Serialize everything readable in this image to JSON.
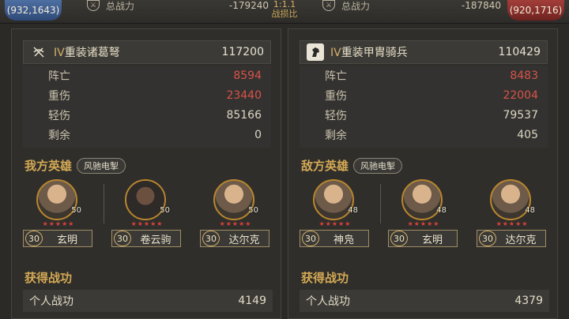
{
  "top": {
    "left_coord": "(932,1643)",
    "right_coord": "(920,1716)",
    "left_power_label": "总战力",
    "left_power_value": "-179240",
    "right_power_label": "总战力",
    "right_power_value": "-187840",
    "ratio_value": "1:1.1",
    "ratio_label": "战损比"
  },
  "left": {
    "unit": {
      "tier": "IV",
      "name": "重装诸葛弩",
      "total": "117200"
    },
    "stats": [
      {
        "label": "阵亡",
        "value": "8594",
        "red": true
      },
      {
        "label": "重伤",
        "value": "23440",
        "red": true
      },
      {
        "label": "轻伤",
        "value": "85166",
        "red": false
      },
      {
        "label": "剩余",
        "value": "0",
        "red": false
      }
    ],
    "heroes_title": "我方英雄",
    "tag": "风驰电掣",
    "heroes": [
      {
        "name": "玄明",
        "level": "50",
        "badge": "30",
        "stars": "★★★★★"
      },
      {
        "name": "卷云驹",
        "level": "50",
        "badge": "30",
        "stars": "★★★★★"
      },
      {
        "name": "达尔克",
        "level": "50",
        "badge": "30",
        "stars": "★★★★★"
      }
    ],
    "merit_title": "获得战功",
    "merit_label": "个人战功",
    "merit_value": "4149"
  },
  "right": {
    "unit": {
      "tier": "IV",
      "name": "重装甲胄骑兵",
      "total": "110429"
    },
    "stats": [
      {
        "label": "阵亡",
        "value": "8483",
        "red": true
      },
      {
        "label": "重伤",
        "value": "22004",
        "red": true
      },
      {
        "label": "轻伤",
        "value": "79537",
        "red": false
      },
      {
        "label": "剩余",
        "value": "405",
        "red": false
      }
    ],
    "heroes_title": "敌方英雄",
    "tag": "风驰电掣",
    "heroes": [
      {
        "name": "神凫",
        "level": "48",
        "badge": "30",
        "stars": "★★★★★"
      },
      {
        "name": "玄明",
        "level": "48",
        "badge": "30",
        "stars": "★★★★★"
      },
      {
        "name": "达尔克",
        "level": "48",
        "badge": "30",
        "stars": "★★★★★"
      }
    ],
    "merit_title": "获得战功",
    "merit_label": "个人战功",
    "merit_value": "4379"
  }
}
